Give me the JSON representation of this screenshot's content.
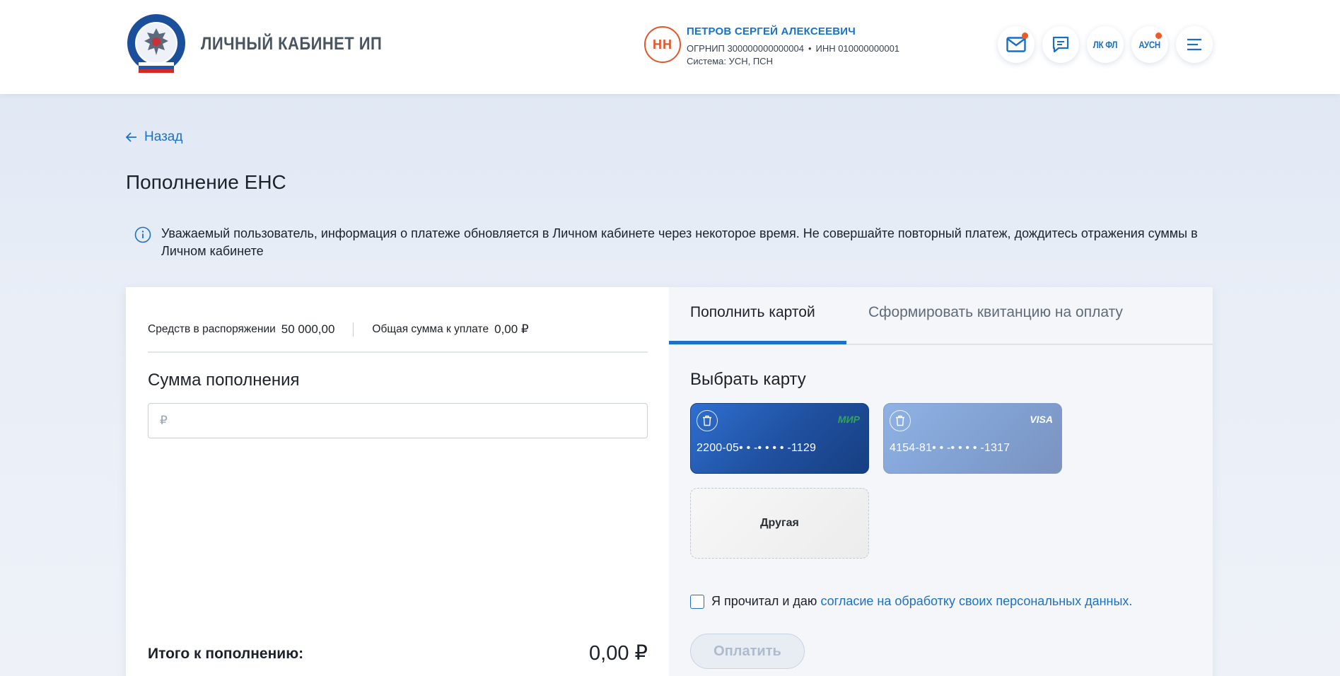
{
  "header": {
    "brand_title": "ЛИЧНЫЙ КАБИНЕТ ИП",
    "user": {
      "initials": "НН",
      "name": "ПЕТРОВ СЕРГЕЙ АЛЕКСЕЕВИЧ",
      "ogrnip": "ОГРНИП 300000000000004",
      "inn": "ИНН 010000000001",
      "system": "Система: УСН, ПСН"
    },
    "buttons": {
      "lk_fl": "ЛК ФЛ",
      "ausn": "АУСН"
    }
  },
  "nav": {
    "back_label": "Назад"
  },
  "page": {
    "title": "Пополнение ЕНС",
    "info_text": "Уважаемый пользователь, информация о платеже обновляется в Личном кабинете через некоторое время. Не совершайте повторный платеж, дождитесь отражения суммы в Личном кабинете"
  },
  "balances": {
    "available_label": "Средств в распоряжении",
    "available_value": "50 000,00",
    "due_label": "Общая сумма к уплате",
    "due_value": "0,00 ₽"
  },
  "topup": {
    "title": "Сумма пополнения",
    "input_placeholder": "₽",
    "input_value": "",
    "total_label": "Итого к пополнению:",
    "total_value": "0,00 ₽"
  },
  "tabs": {
    "card_tab": "Пополнить картой",
    "receipt_tab": "Сформировать квитанцию на оплату"
  },
  "cards": {
    "title": "Выбрать карту",
    "items": [
      {
        "brand": "МИР",
        "number": "2200-05• • -• • • • -1129"
      },
      {
        "brand": "VISA",
        "number": "4154-81• • -• • • • -1317"
      }
    ],
    "other_label": "Другая"
  },
  "consent": {
    "text": "Я прочитал и даю",
    "link": "согласие на обработку своих персональных данных."
  },
  "pay_button": "Оплатить",
  "colors": {
    "accent": "#1a72c7",
    "avatar": "#e2562b",
    "notification": "#ee5a24"
  }
}
